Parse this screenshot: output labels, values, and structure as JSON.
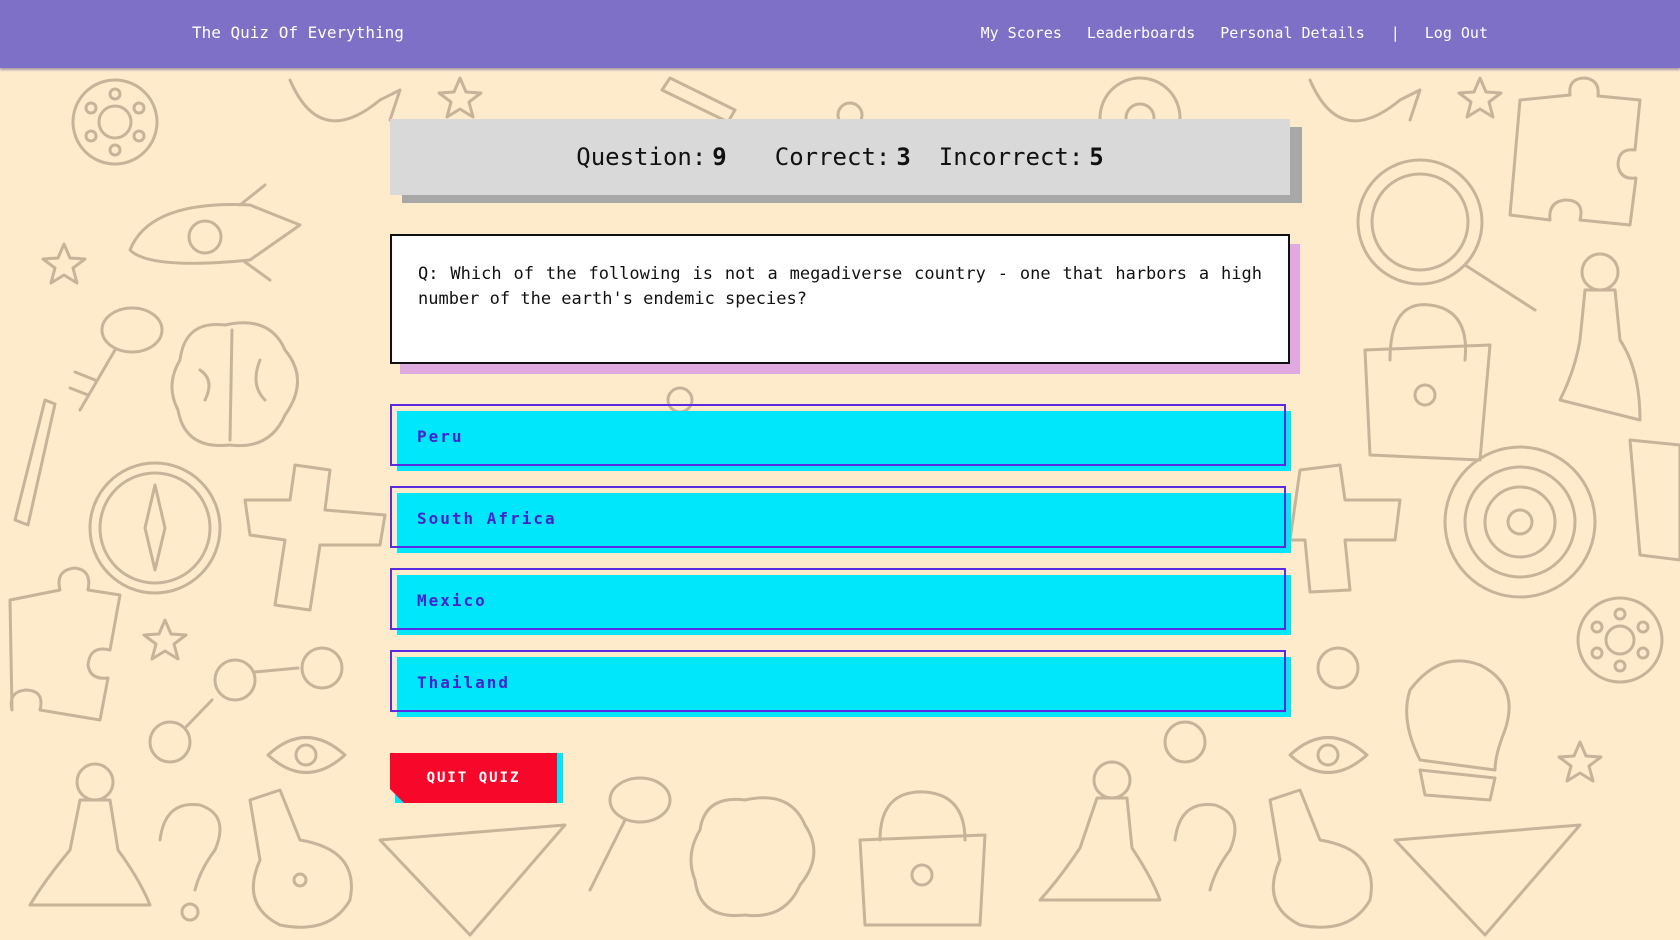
{
  "header": {
    "brand": "The Quiz Of Everything",
    "links": [
      "My Scores",
      "Leaderboards",
      "Personal Details"
    ],
    "separator": "|",
    "logout": "Log Out"
  },
  "stats": {
    "question_label": "Question:",
    "question_value": "9",
    "correct_label": "Correct:",
    "correct_value": "3",
    "incorrect_label": "Incorrect:",
    "incorrect_value": "5"
  },
  "question": {
    "text": "Q: Which of the following is not a megadiverse country - one that harbors a high number of the earth's endemic species?"
  },
  "answers": [
    "Peru",
    "South Africa",
    "Mexico",
    "Thailand"
  ],
  "quit_label": "QUIT QUIZ",
  "colors": {
    "navbar": "#7e6fc7",
    "background": "#fdebcb",
    "doodle_stroke": "#c8b39a",
    "stats_panel": "#d9d9d9",
    "question_shadow": "#e0a9df",
    "answer_fill": "#00e7fb",
    "answer_border": "#5a2be0",
    "quit_button": "#f7082a"
  },
  "icons": [
    "gear-icon",
    "star-icon",
    "rocket-icon",
    "key-icon",
    "brain-icon",
    "pencil-icon",
    "compass-icon",
    "puzzle-icon",
    "magnifier-icon",
    "lock-icon",
    "chess-pawn-icon",
    "target-icon",
    "lightbulb-icon",
    "eye-icon",
    "question-mark-icon",
    "flask-icon",
    "ruler-icon"
  ]
}
